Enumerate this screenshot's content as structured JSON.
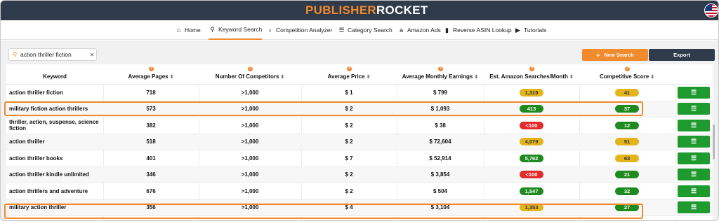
{
  "app": {
    "logo_part1": "PUBLISHER",
    "logo_part2": "ROCKET",
    "flag_icon": "us-flag-icon"
  },
  "nav": [
    {
      "label": "Home",
      "icon": "home-icon"
    },
    {
      "label": "Keyword Search",
      "icon": "search-icon",
      "active": true
    },
    {
      "label": "Competition Analyzer",
      "icon": "award-icon"
    },
    {
      "label": "Category Search",
      "icon": "list-icon"
    },
    {
      "label": "Amazon Ads",
      "icon": "amazon-icon"
    },
    {
      "label": "Reverse ASIN Lookup",
      "icon": "book-icon"
    },
    {
      "label": "Tutorials",
      "icon": "play-icon"
    }
  ],
  "search": {
    "query": "action thriller fiction",
    "new_search_label": "New Search",
    "export_label": "Export"
  },
  "table": {
    "headers": [
      "Keyword",
      "Average Pages",
      "Number Of Competitors",
      "Average Price",
      "Average Monthly Earnings",
      "Est. Amazon Searches/Month",
      "Competitive Score"
    ],
    "rows": [
      {
        "keyword": "action thriller fiction",
        "pages": "718",
        "competitors": ">1,000",
        "price": "$ 1",
        "earnings": "$ 799",
        "searches": "1,319",
        "searches_color": "yellow",
        "score": "41",
        "score_color": "yellow"
      },
      {
        "keyword": "military fiction action thrillers",
        "pages": "573",
        "competitors": ">1,000",
        "price": "$ 2",
        "earnings": "$ 1,093",
        "searches": "413",
        "searches_color": "green",
        "score": "37",
        "score_color": "green"
      },
      {
        "keyword": "thriller, action, suspense, science fiction",
        "pages": "382",
        "competitors": ">1,000",
        "price": "$ 2",
        "earnings": "$ 38",
        "searches": "<100",
        "searches_color": "red",
        "score": "12",
        "score_color": "green"
      },
      {
        "keyword": "action thriller",
        "pages": "518",
        "competitors": ">1,000",
        "price": "$ 2",
        "earnings": "$ 72,604",
        "searches": "4,079",
        "searches_color": "yellow",
        "score": "51",
        "score_color": "yellow"
      },
      {
        "keyword": "action thriller books",
        "pages": "401",
        "competitors": ">1,000",
        "price": "$ 7",
        "earnings": "$ 52,914",
        "searches": "5,762",
        "searches_color": "green",
        "score": "63",
        "score_color": "yellow"
      },
      {
        "keyword": "action thriller kindle unlimited",
        "pages": "346",
        "competitors": ">1,000",
        "price": "$ 2",
        "earnings": "$ 3,854",
        "searches": "<100",
        "searches_color": "red",
        "score": "21",
        "score_color": "green"
      },
      {
        "keyword": "action thrillers and adventure",
        "pages": "676",
        "competitors": ">1,000",
        "price": "$ 2",
        "earnings": "$ 504",
        "searches": "1,547",
        "searches_color": "green",
        "score": "32",
        "score_color": "green"
      },
      {
        "keyword": "military action thriller",
        "pages": "356",
        "competitors": ">1,000",
        "price": "$ 4",
        "earnings": "$ 3,104",
        "searches": "1,353",
        "searches_color": "yellow",
        "score": "27",
        "score_color": "green"
      }
    ],
    "highlighted_rows": [
      1,
      7
    ]
  },
  "colors": {
    "accent": "#f28a2e",
    "header_bg": "#2f3a4b",
    "green": "#1f8a1f",
    "yellow": "#e3b41b",
    "red": "#e22b2b"
  }
}
